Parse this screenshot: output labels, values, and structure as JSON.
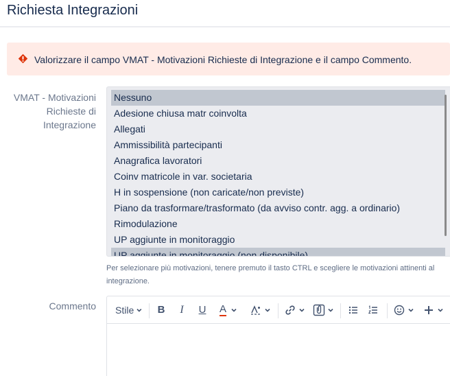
{
  "page": {
    "title": "Richiesta Integrazioni"
  },
  "error": {
    "message": "Valorizzare il campo VMAT - Motivazioni Richieste di Integrazione e il campo Commento.",
    "color": "#de350b",
    "icon": "error-icon"
  },
  "vmat": {
    "label_line1": "VMAT - Motivazioni",
    "label_line2": "Richieste di",
    "label_line3": "Integrazione",
    "options": [
      {
        "label": "Nessuno",
        "selected": true
      },
      {
        "label": "Adesione chiusa matr coinvolta",
        "selected": false
      },
      {
        "label": "Allegati",
        "selected": false
      },
      {
        "label": "Ammissibilità partecipanti",
        "selected": false
      },
      {
        "label": "Anagrafica lavoratori",
        "selected": false
      },
      {
        "label": "Coinv matricole in var. societaria",
        "selected": false
      },
      {
        "label": "H in sospensione (non caricate/non previste)",
        "selected": false
      },
      {
        "label": "Piano da trasformare/trasformato (da avviso contr. agg. a ordinario)",
        "selected": false
      },
      {
        "label": "Rimodulazione",
        "selected": false
      },
      {
        "label": "UP aggiunte in monitoraggio",
        "selected": false
      },
      {
        "label": "UP aggiunte in monitoraggio (non disponibile)",
        "selected": true
      }
    ],
    "hint_line1": "Per selezionare più motivazioni, tenere premuto il tasto CTRL e scegliere le motivazioni attinenti al",
    "hint_line2": "integrazione."
  },
  "commento": {
    "label": "Commento",
    "toolbar": {
      "style_label": "Stile",
      "bold": "B",
      "italic": "I",
      "underline": "U",
      "text_color": "A",
      "text_color_value": "#de350b"
    }
  }
}
